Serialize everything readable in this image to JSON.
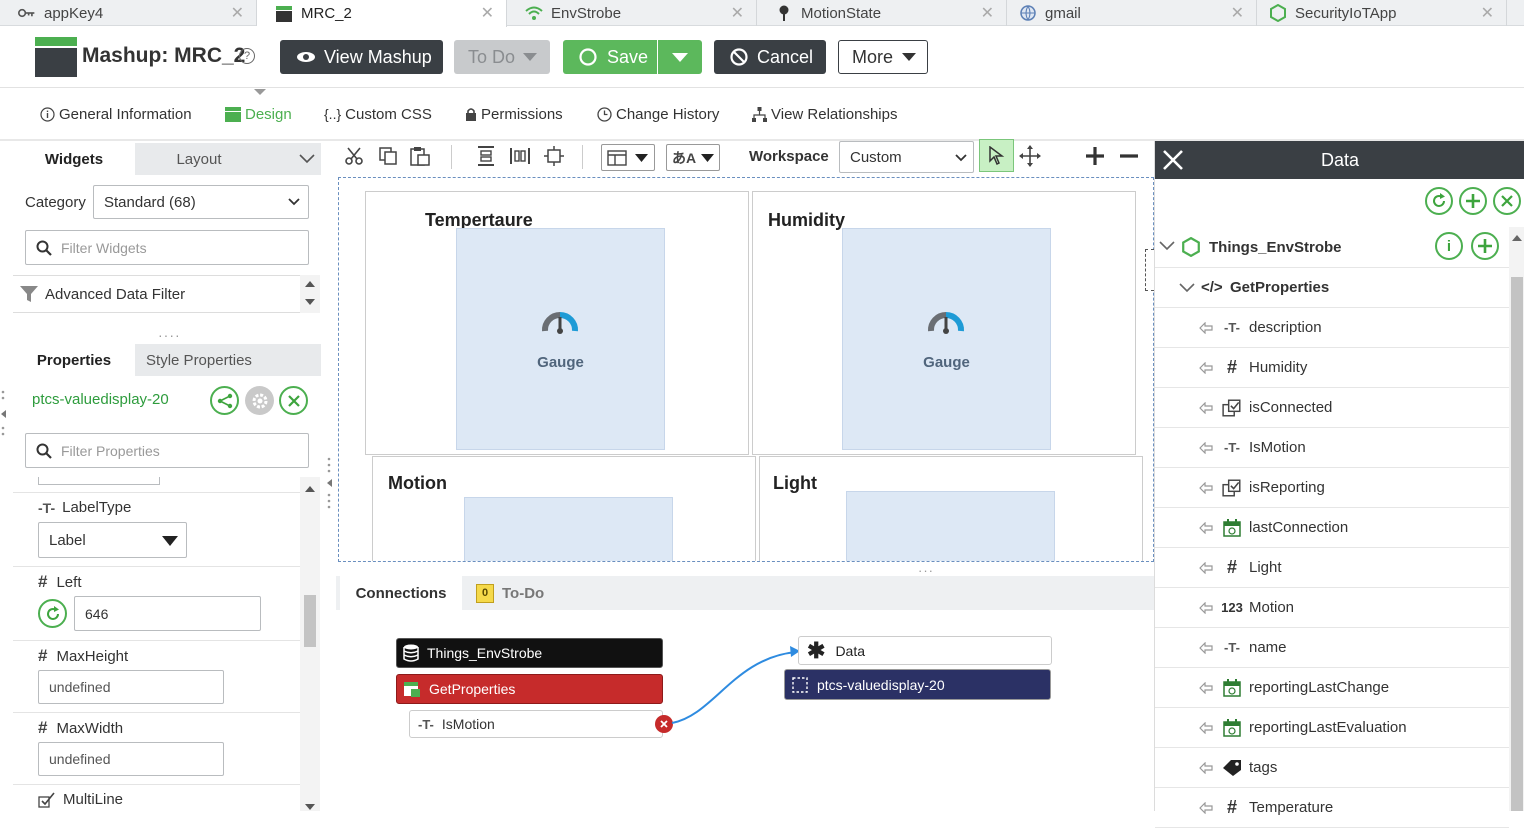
{
  "browser_tabs": [
    {
      "label": "appKey4",
      "icon": "key-icon",
      "active": false
    },
    {
      "label": "MRC_2",
      "icon": "mashup-icon",
      "active": true
    },
    {
      "label": "EnvStrobe",
      "icon": "wifi-icon",
      "active": false
    },
    {
      "label": "MotionState",
      "icon": "pin-icon",
      "active": false
    },
    {
      "label": "gmail",
      "icon": "globe-icon",
      "active": false
    },
    {
      "label": "SecurityIoTApp",
      "icon": "hexagon-icon",
      "active": false
    }
  ],
  "header": {
    "title": "Mashup: MRC_2",
    "view_mashup": "View Mashup",
    "todo": "To Do",
    "save": "Save",
    "cancel": "Cancel",
    "more": "More"
  },
  "subnav": {
    "general": "General Information",
    "design": "Design",
    "css": "Custom CSS",
    "permissions": "Permissions",
    "history": "Change History",
    "relationships": "View Relationships"
  },
  "widgets_panel": {
    "tab_widgets": "Widgets",
    "tab_layout": "Layout",
    "category_label": "Category",
    "category_value": "Standard (68)",
    "filter_placeholder": "Filter Widgets",
    "item": "Advanced Data Filter"
  },
  "properties_panel": {
    "tab_properties": "Properties",
    "tab_style": "Style Properties",
    "widget_id": "ptcs-valuedisplay-20",
    "filter_placeholder": "Filter Properties",
    "props": {
      "labeltype": {
        "label": "LabelType",
        "value": "Label"
      },
      "left": {
        "label": "Left",
        "value": "646"
      },
      "maxheight": {
        "label": "MaxHeight",
        "value": "undefined"
      },
      "maxwidth": {
        "label": "MaxWidth",
        "value": "undefined"
      },
      "multiline": {
        "label": "MultiLine"
      }
    }
  },
  "toolbar": {
    "workspace_label": "Workspace",
    "workspace_value": "Custom"
  },
  "canvas": {
    "cells": [
      {
        "title": "Tempertaure",
        "gauge_label": "Gauge"
      },
      {
        "title": "Humidity",
        "gauge_label": "Gauge"
      },
      {
        "title": "Motion"
      },
      {
        "title": "Light"
      }
    ]
  },
  "connections": {
    "tab_connections": "Connections",
    "tab_todo": "To-Do",
    "todo_count": "0",
    "source_thing": "Things_EnvStrobe",
    "source_service": "GetProperties",
    "source_field": "IsMotion",
    "target_data": "Data",
    "target_widget": "ptcs-valuedisplay-20"
  },
  "data_panel": {
    "title": "Data",
    "thing": "Things_EnvStrobe",
    "service": "GetProperties",
    "fields": [
      {
        "label": "description",
        "type": "string"
      },
      {
        "label": "Humidity",
        "type": "number"
      },
      {
        "label": "isConnected",
        "type": "boolean"
      },
      {
        "label": "IsMotion",
        "type": "string"
      },
      {
        "label": "isReporting",
        "type": "boolean"
      },
      {
        "label": "lastConnection",
        "type": "datetime"
      },
      {
        "label": "Light",
        "type": "number"
      },
      {
        "label": "Motion",
        "type": "integer"
      },
      {
        "label": "name",
        "type": "string"
      },
      {
        "label": "reportingLastChange",
        "type": "datetime"
      },
      {
        "label": "reportingLastEvaluation",
        "type": "datetime"
      },
      {
        "label": "tags",
        "type": "tags"
      },
      {
        "label": "Temperature",
        "type": "number"
      }
    ]
  },
  "colors": {
    "green": "#5cb85c",
    "dark": "#3a3f44",
    "thing_node": "#111111",
    "service_node": "#c62b2b",
    "widget_node": "#2b3165",
    "data_header": "#3a3f44",
    "accent_link": "#2e9c3d"
  }
}
